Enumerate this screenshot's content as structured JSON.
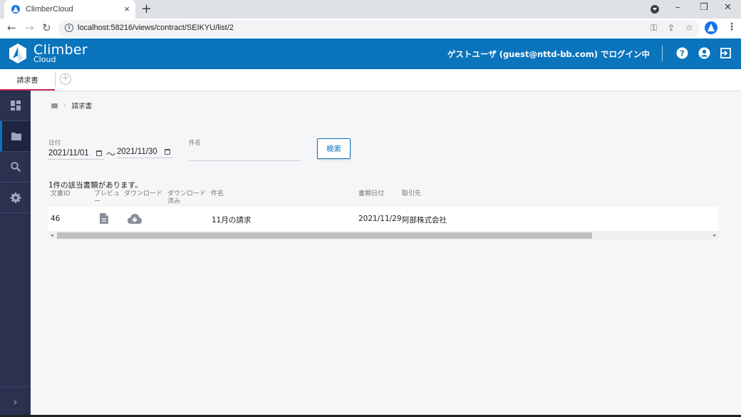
{
  "browser": {
    "tab_title": "ClimberCloud",
    "tab_close": "×",
    "new_tab": "+",
    "url": "localhost:58216/views/contract/SEIKYU/list/2",
    "window_controls": {
      "minimize": "–",
      "restore": "❐",
      "close": "✕"
    }
  },
  "header": {
    "logo_line1": "Climber",
    "logo_line2": "Cloud",
    "login_status": "ゲストユーザ (guest@nttd-bb.com) でログイン中"
  },
  "app_tabs": [
    {
      "label": "請求書",
      "active": true
    }
  ],
  "add_tab": "+",
  "sidebar": {
    "items": [
      {
        "name": "dashboard",
        "active": false
      },
      {
        "name": "documents",
        "active": true
      },
      {
        "name": "search",
        "active": false
      },
      {
        "name": "settings",
        "active": false
      }
    ],
    "expand": "›"
  },
  "breadcrumb": {
    "separator": "›",
    "current": "請求書"
  },
  "filters": {
    "date_label": "日付",
    "date_from": "2021/11/01",
    "date_range_sep": "〜",
    "date_to": "2021/11/30",
    "subject_label": "件名",
    "subject_value": "",
    "search_button": "検索"
  },
  "results": {
    "count_text": "1件の該当書類があります。",
    "columns": [
      "文書ID",
      "プレビュー",
      "ダウンロード",
      "ダウンロード済み",
      "件名",
      "書類日付",
      "取引先"
    ],
    "rows": [
      {
        "doc_id": "46",
        "preview_icon": "document-icon",
        "download_icon": "cloud-download-icon",
        "downloaded": "",
        "subject": "11月の請求",
        "doc_date": "2021/11/29",
        "partner": "阿部株式会社"
      }
    ]
  },
  "colors": {
    "brand_blue": "#0a74bd",
    "sidebar_bg": "#2b3250",
    "active_tab_underline": "#d0285c"
  }
}
